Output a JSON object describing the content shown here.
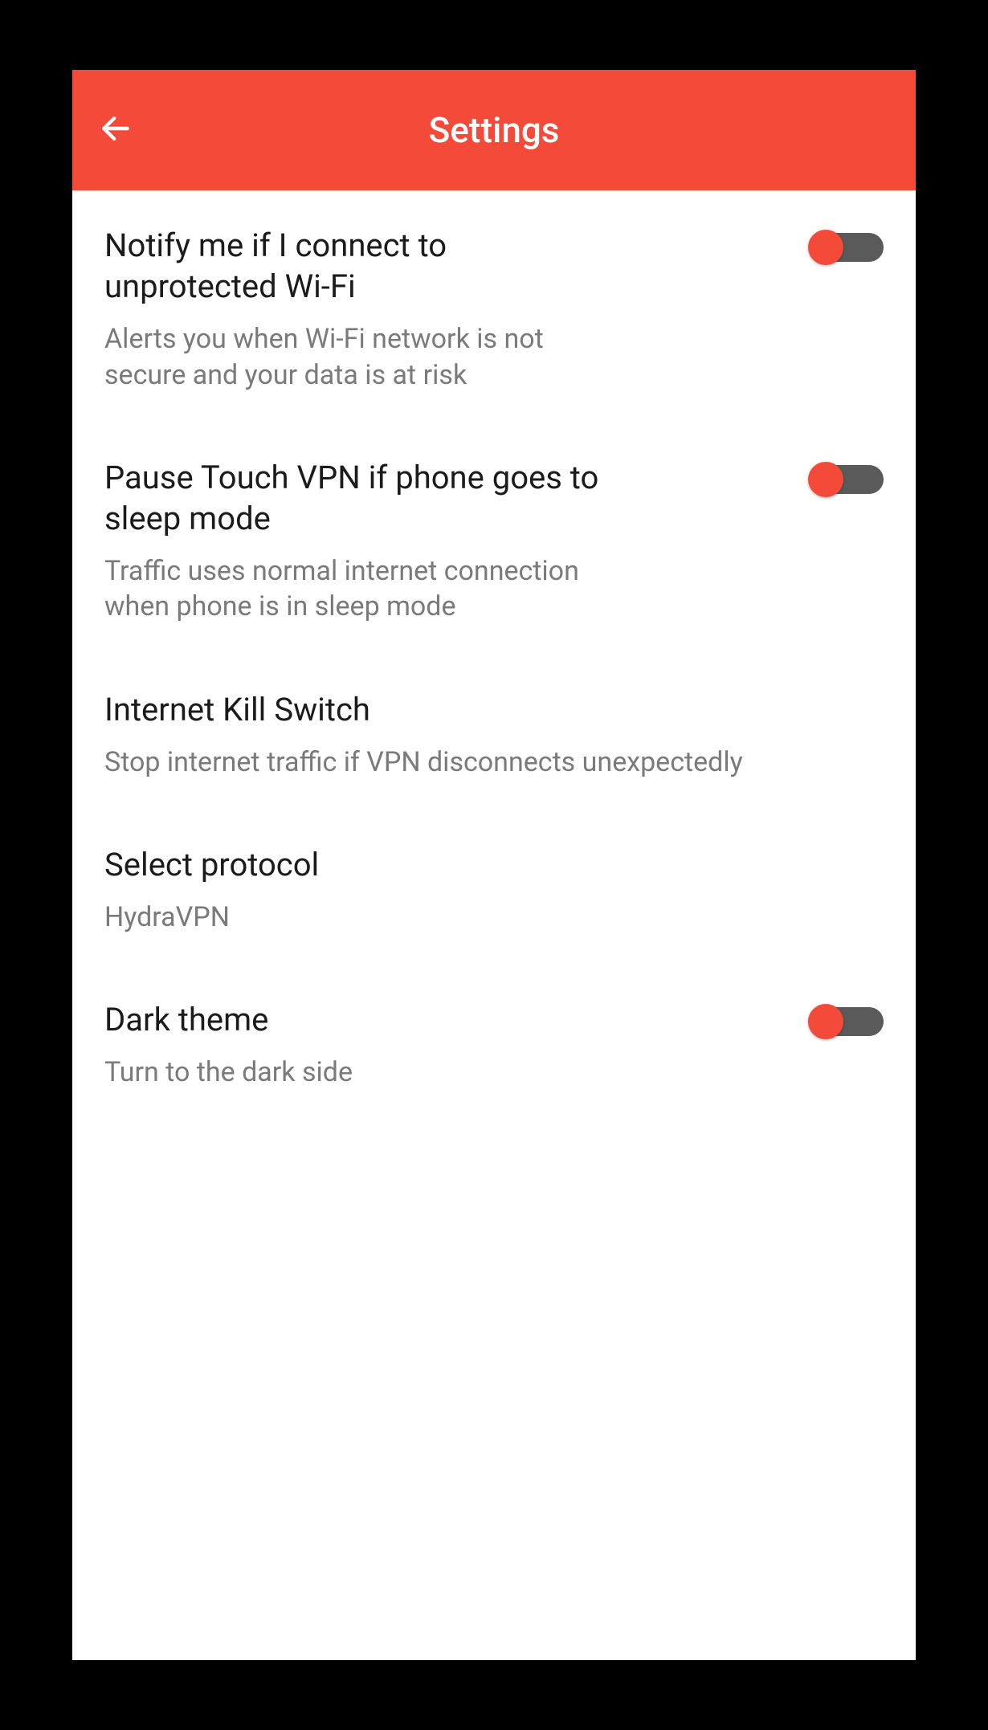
{
  "header": {
    "title": "Settings"
  },
  "settings": {
    "wifi": {
      "title": "Notify me if I connect to unprotected Wi-Fi",
      "desc": "Alerts you when Wi-Fi network is not secure and your data is at risk",
      "on": true
    },
    "sleep": {
      "title": "Pause Touch VPN if phone goes to sleep mode",
      "desc": "Traffic uses normal internet connection when phone is in sleep mode",
      "on": true
    },
    "kill": {
      "title": "Internet Kill Switch",
      "desc": "Stop internet traffic if VPN disconnects unexpectedly"
    },
    "protocol": {
      "title": "Select protocol",
      "desc": "HydraVPN"
    },
    "dark": {
      "title": "Dark theme",
      "desc": "Turn to the dark side",
      "on": true
    }
  }
}
